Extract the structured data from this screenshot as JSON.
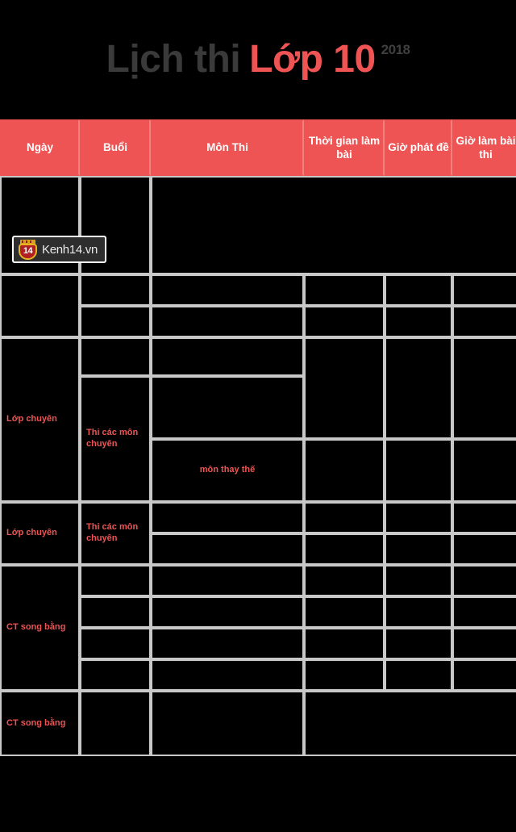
{
  "title": {
    "main": "Lịch thi",
    "accent": "Lớp 10",
    "year": "2018"
  },
  "watermark": {
    "badge_number": "14",
    "text": "Kenh14.vn"
  },
  "table": {
    "columns": [
      "Ngày",
      "Buổi",
      "Môn Thi",
      "Thời gian làm bài",
      "Giờ phát đề",
      "Giờ làm bài thi"
    ],
    "col_headers": {
      "ngay": "Ngày",
      "buoi": "Buổi",
      "mon_thi": "Môn Thi",
      "thoi_gian": "Thời gian làm bài",
      "gio_phat_de": "Giờ phát đề",
      "gio_lam_bai": "Giờ làm bài thi"
    },
    "blocks": [
      {
        "id": "block-1",
        "ngay": "",
        "rows": [
          {
            "buoi": "",
            "mon_thi": "",
            "thoi_gian": "",
            "gio_phat_de": "",
            "gio_lam_bai": ""
          }
        ]
      },
      {
        "id": "block-2",
        "ngay": "",
        "rows": [
          {
            "buoi": "",
            "mon_thi": "",
            "thoi_gian": "",
            "gio_phat_de": "",
            "gio_lam_bai": ""
          },
          {
            "buoi": "",
            "mon_thi": "",
            "thoi_gian": "",
            "gio_phat_de": "",
            "gio_lam_bai": ""
          }
        ]
      },
      {
        "id": "block-3",
        "ngay": "Lớp chuyên",
        "rows": [
          {
            "buoi": "",
            "mon_thi": "",
            "thoi_gian": "",
            "gio_phat_de": "",
            "gio_lam_bai": ""
          },
          {
            "buoi": "Thi các môn chuyên",
            "mon_thi": "",
            "thoi_gian": "",
            "gio_phat_de": "",
            "gio_lam_bai": ""
          },
          {
            "buoi": "",
            "mon_thi": "môn thay thế",
            "thoi_gian": "",
            "gio_phat_de": "",
            "gio_lam_bai": ""
          }
        ]
      },
      {
        "id": "block-4",
        "ngay": "Lớp chuyên",
        "rows": [
          {
            "buoi": "Thi các môn chuyên",
            "mon_thi": "",
            "thoi_gian": "",
            "gio_phat_de": "",
            "gio_lam_bai": ""
          },
          {
            "buoi": "",
            "mon_thi": "",
            "thoi_gian": "",
            "gio_phat_de": "",
            "gio_lam_bai": ""
          }
        ]
      },
      {
        "id": "block-5",
        "ngay": "CT song bằng",
        "rows": [
          {
            "buoi": "",
            "mon_thi": "",
            "thoi_gian": "",
            "gio_phat_de": "",
            "gio_lam_bai": ""
          },
          {
            "buoi": "",
            "mon_thi": "",
            "thoi_gian": "",
            "gio_phat_de": "",
            "gio_lam_bai": ""
          },
          {
            "buoi": "",
            "mon_thi": "",
            "thoi_gian": "",
            "gio_phat_de": "",
            "gio_lam_bai": ""
          },
          {
            "buoi": "",
            "mon_thi": "",
            "thoi_gian": "",
            "gio_phat_de": "",
            "gio_lam_bai": ""
          }
        ]
      },
      {
        "id": "block-6",
        "ngay": "CT song bằng",
        "rows": [
          {
            "buoi": "",
            "mon_thi": "",
            "merged_rest": ""
          }
        ]
      }
    ]
  },
  "colors": {
    "accent_red": "#ee5454",
    "title_dark": "#3a3a3a",
    "grid_line": "#c8c8c8",
    "background": "#000000"
  }
}
